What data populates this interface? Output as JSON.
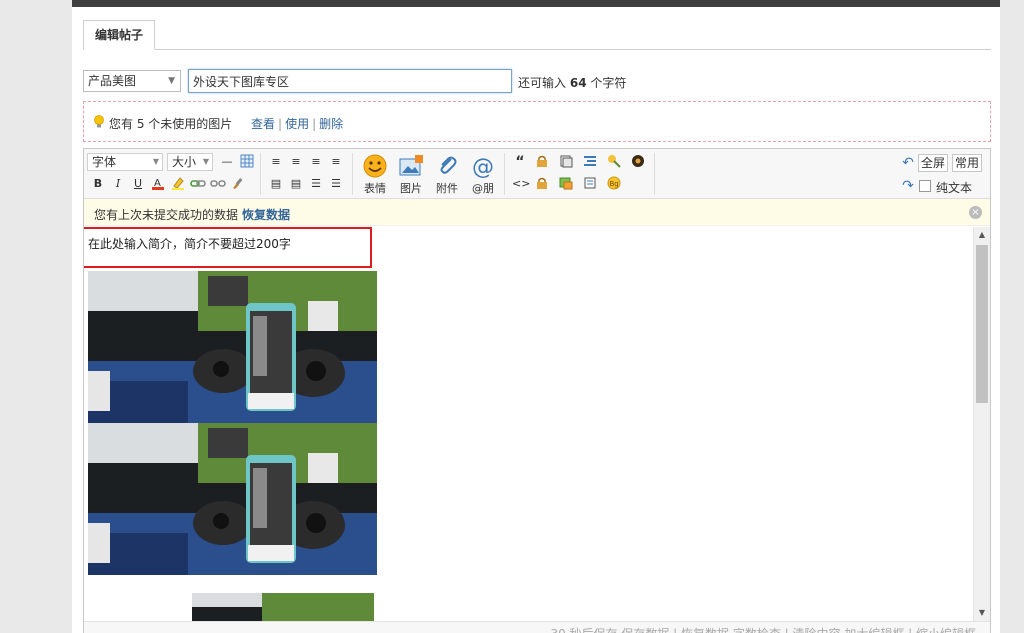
{
  "tab": {
    "label": "编辑帖子"
  },
  "subject": {
    "category": "产品美图",
    "title_value": "外设天下图库专区",
    "remain_prefix": "还可输入",
    "remain_count": "64",
    "remain_suffix": "个字符"
  },
  "unused_images": {
    "message": "您有 5 个未使用的图片",
    "view": "查看",
    "use": "使用",
    "delete": "删除"
  },
  "toolbar": {
    "font": "字体",
    "size": "大小",
    "bold": "B",
    "italic": "I",
    "underline": "U",
    "emoji": "表情",
    "image": "图片",
    "attach": "附件",
    "at_friend": "@朋",
    "fullscreen": "全屏",
    "common": "常用",
    "plaintext": "纯文本",
    "quote": "“",
    "code": "<>"
  },
  "notice": {
    "text": "您有上次未提交成功的数据",
    "restore": "恢复数据"
  },
  "editor": {
    "intro": "在此处输入简介，简介不要超过200字"
  },
  "status": {
    "text": "30 秒后保存 保存数据 | 恢复数据   字数检查 | 清除内容   加大编辑框 | 缩小编辑框"
  },
  "colors": {
    "accent": "#336699",
    "highlight": "#d81e1e",
    "notice_bg": "#fefbe6"
  }
}
